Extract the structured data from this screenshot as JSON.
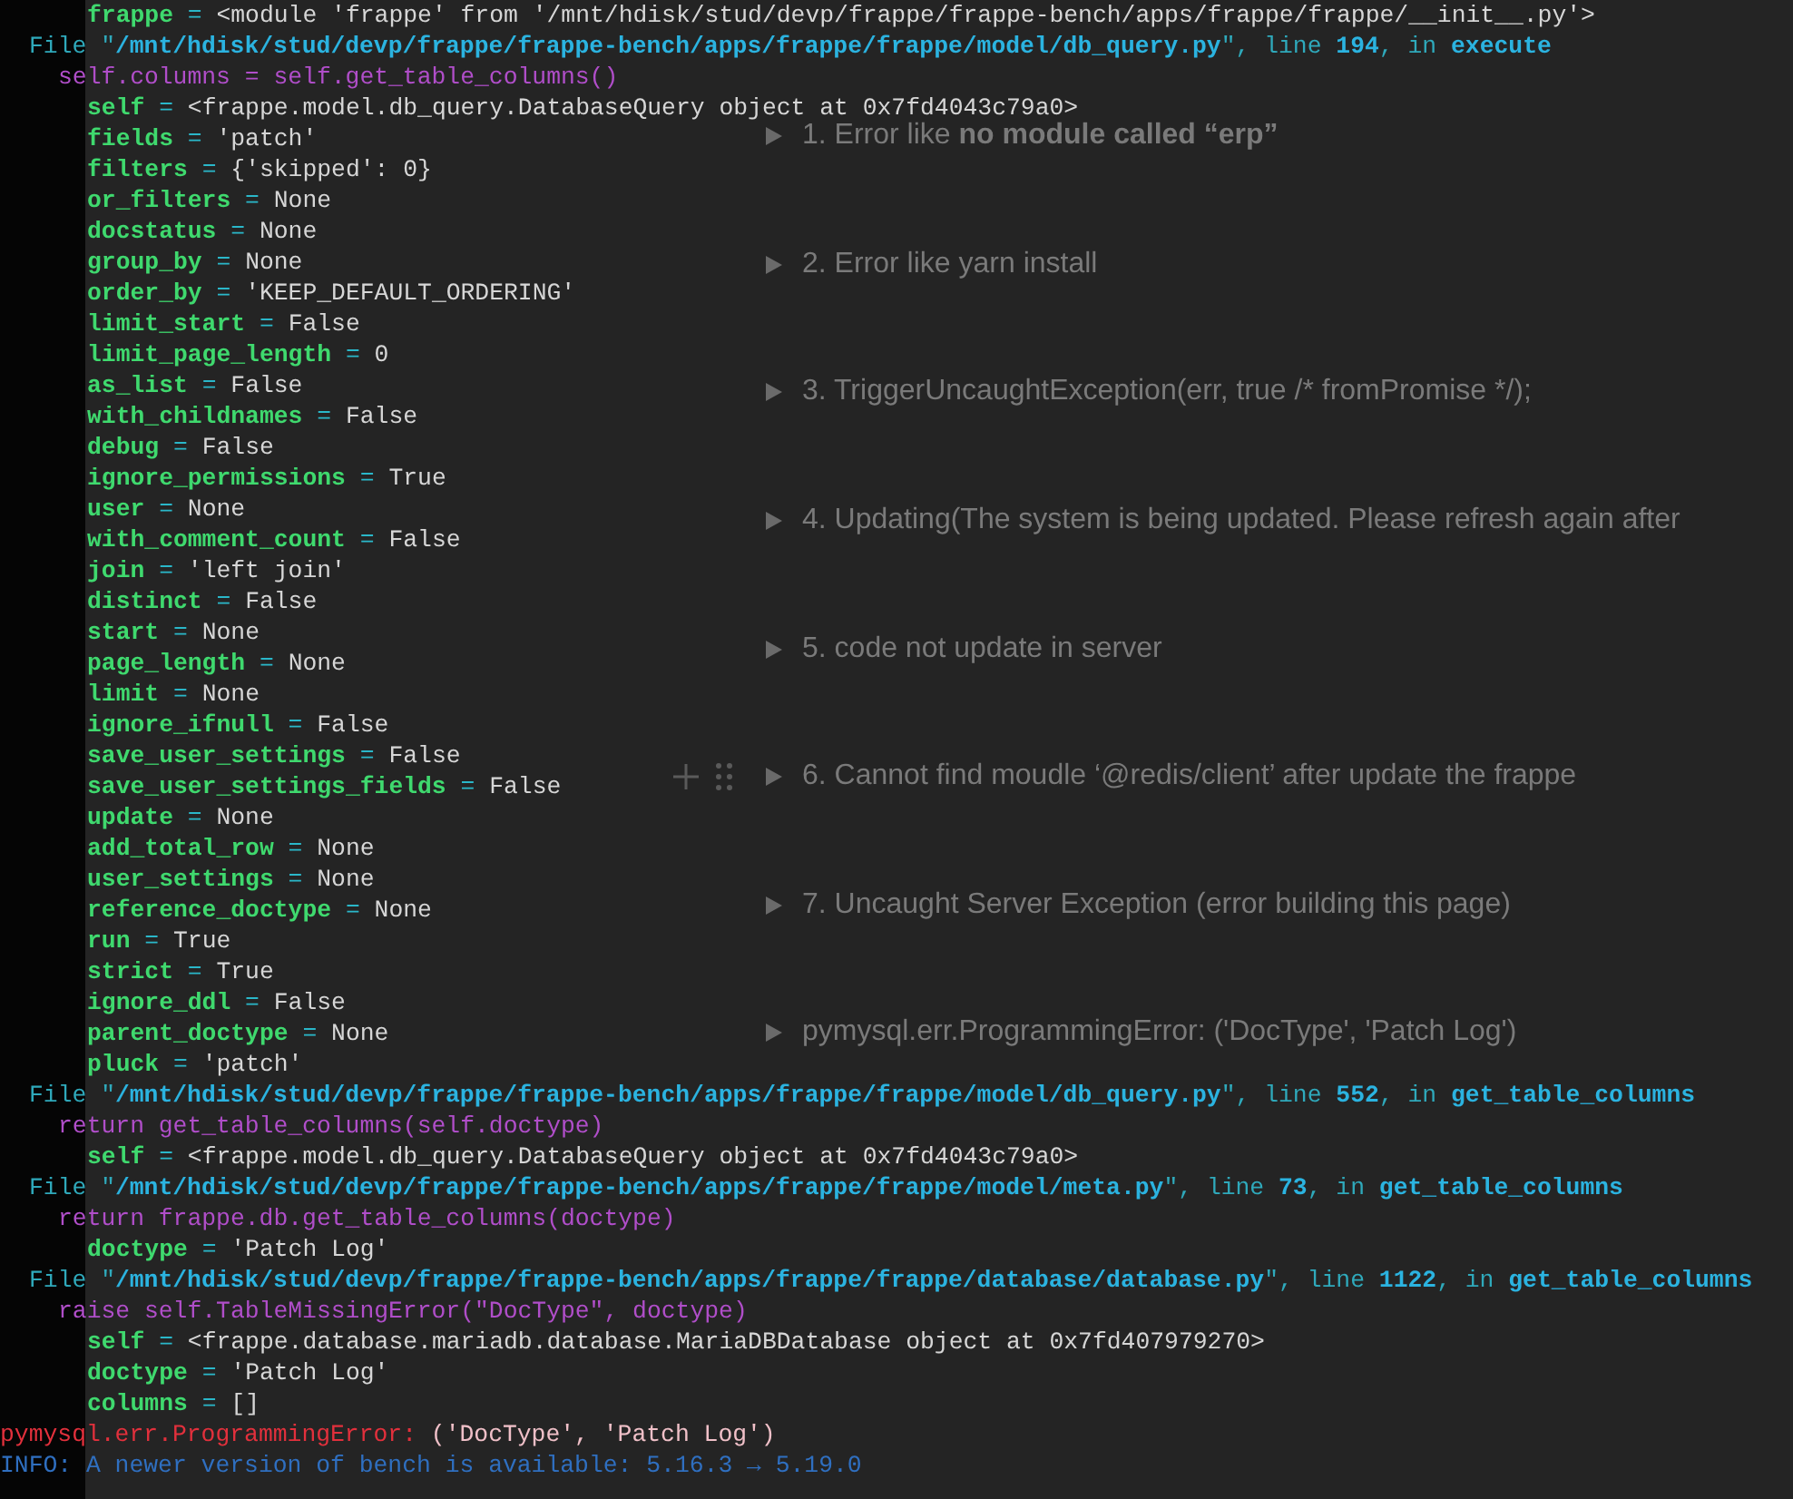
{
  "page": {
    "toggles": [
      {
        "text": "1. Error like **no module called “erp”**",
        "hovered": false
      },
      {
        "text": "2. Error like yarn install",
        "hovered": false
      },
      {
        "text": "3. TriggerUncaughtException(err, true /* fromPromise */);",
        "hovered": false
      },
      {
        "text": "4. Updating(The system is being updated. Please refresh again after",
        "hovered": false
      },
      {
        "text": "5. code not update in server",
        "hovered": false
      },
      {
        "text": "6. Cannot find moudle ‘@redis/client’ after update the frappe",
        "hovered": true
      },
      {
        "text": "7. Uncaught Server Exception (error building this page)",
        "hovered": false
      },
      {
        "text": "pymysql.err.ProgrammingError: ('DocType', 'Patch Log')",
        "hovered": false
      }
    ]
  },
  "terminal": {
    "lines": [
      {
        "kind": "var",
        "name": "frappe",
        "op": " = ",
        "value": "<module 'frappe' from '/mnt/hdisk/stud/devp/frappe/frappe-bench/apps/frappe/frappe/__init__.py'>"
      },
      {
        "kind": "file",
        "prefix": "File \"",
        "path": "/mnt/hdisk/stud/devp/frappe/frappe-bench/apps/frappe/frappe/model/db_query.py",
        "line_label": "\", line ",
        "line": "194",
        "in_label": ", in ",
        "func": "execute"
      },
      {
        "kind": "code",
        "text": "self.columns = self.get_table_columns()"
      },
      {
        "kind": "var",
        "name": "self",
        "op": " = ",
        "value": "<frappe.model.db_query.DatabaseQuery object at 0x7fd4043c79a0>"
      },
      {
        "kind": "var",
        "name": "fields",
        "op": " = ",
        "value": "'patch'"
      },
      {
        "kind": "var",
        "name": "filters",
        "op": " = ",
        "value": "{'skipped': 0}"
      },
      {
        "kind": "var",
        "name": "or_filters",
        "op": " = ",
        "value": "None"
      },
      {
        "kind": "var",
        "name": "docstatus",
        "op": " = ",
        "value": "None"
      },
      {
        "kind": "var",
        "name": "group_by",
        "op": " = ",
        "value": "None"
      },
      {
        "kind": "var",
        "name": "order_by",
        "op": " = ",
        "value": "'KEEP_DEFAULT_ORDERING'"
      },
      {
        "kind": "var",
        "name": "limit_start",
        "op": " = ",
        "value": "False"
      },
      {
        "kind": "var",
        "name": "limit_page_length",
        "op": " = ",
        "value": "0"
      },
      {
        "kind": "var",
        "name": "as_list",
        "op": " = ",
        "value": "False"
      },
      {
        "kind": "var",
        "name": "with_childnames",
        "op": " = ",
        "value": "False"
      },
      {
        "kind": "var",
        "name": "debug",
        "op": " = ",
        "value": "False"
      },
      {
        "kind": "var",
        "name": "ignore_permissions",
        "op": " = ",
        "value": "True"
      },
      {
        "kind": "var",
        "name": "user",
        "op": " = ",
        "value": "None"
      },
      {
        "kind": "var",
        "name": "with_comment_count",
        "op": " = ",
        "value": "False"
      },
      {
        "kind": "var",
        "name": "join",
        "op": " = ",
        "value": "'left join'"
      },
      {
        "kind": "var",
        "name": "distinct",
        "op": " = ",
        "value": "False"
      },
      {
        "kind": "var",
        "name": "start",
        "op": " = ",
        "value": "None"
      },
      {
        "kind": "var",
        "name": "page_length",
        "op": " = ",
        "value": "None"
      },
      {
        "kind": "var",
        "name": "limit",
        "op": " = ",
        "value": "None"
      },
      {
        "kind": "var",
        "name": "ignore_ifnull",
        "op": " = ",
        "value": "False"
      },
      {
        "kind": "var",
        "name": "save_user_settings",
        "op": " = ",
        "value": "False"
      },
      {
        "kind": "var",
        "name": "save_user_settings_fields",
        "op": " = ",
        "value": "False"
      },
      {
        "kind": "var",
        "name": "update",
        "op": " = ",
        "value": "None"
      },
      {
        "kind": "var",
        "name": "add_total_row",
        "op": " = ",
        "value": "None"
      },
      {
        "kind": "var",
        "name": "user_settings",
        "op": " = ",
        "value": "None"
      },
      {
        "kind": "var",
        "name": "reference_doctype",
        "op": " = ",
        "value": "None"
      },
      {
        "kind": "var",
        "name": "run",
        "op": " = ",
        "value": "True"
      },
      {
        "kind": "var",
        "name": "strict",
        "op": " = ",
        "value": "True"
      },
      {
        "kind": "var",
        "name": "ignore_ddl",
        "op": " = ",
        "value": "False"
      },
      {
        "kind": "var",
        "name": "parent_doctype",
        "op": " = ",
        "value": "None"
      },
      {
        "kind": "var",
        "name": "pluck",
        "op": " = ",
        "value": "'patch'"
      },
      {
        "kind": "file",
        "prefix": "File \"",
        "path": "/mnt/hdisk/stud/devp/frappe/frappe-bench/apps/frappe/frappe/model/db_query.py",
        "line_label": "\", line ",
        "line": "552",
        "in_label": ", in ",
        "func": "get_table_columns"
      },
      {
        "kind": "code",
        "text": "return get_table_columns(self.doctype)"
      },
      {
        "kind": "var",
        "name": "self",
        "op": " = ",
        "value": "<frappe.model.db_query.DatabaseQuery object at 0x7fd4043c79a0>"
      },
      {
        "kind": "file",
        "prefix": "File \"",
        "path": "/mnt/hdisk/stud/devp/frappe/frappe-bench/apps/frappe/frappe/model/meta.py",
        "line_label": "\", line ",
        "line": "73",
        "in_label": ", in ",
        "func": "get_table_columns"
      },
      {
        "kind": "code",
        "text": "return frappe.db.get_table_columns(doctype)"
      },
      {
        "kind": "var",
        "name": "doctype",
        "op": " = ",
        "value": "'Patch Log'"
      },
      {
        "kind": "file",
        "prefix": "File \"",
        "path": "/mnt/hdisk/stud/devp/frappe/frappe-bench/apps/frappe/frappe/database/database.py",
        "line_label": "\", line ",
        "line": "1122",
        "in_label": ", in ",
        "func": "get_table_columns"
      },
      {
        "kind": "code",
        "text": "raise self.TableMissingError(\"DocType\", doctype)"
      },
      {
        "kind": "var",
        "name": "self",
        "op": " = ",
        "value": "<frappe.database.mariadb.database.MariaDBDatabase object at 0x7fd407979270>"
      },
      {
        "kind": "var",
        "name": "doctype",
        "op": " = ",
        "value": "'Patch Log'"
      },
      {
        "kind": "var",
        "name": "columns",
        "op": " = ",
        "value": "[]"
      },
      {
        "kind": "error",
        "error": "pymysql.err.ProgrammingError:",
        "detail": " ('DocType', 'Patch Log')"
      },
      {
        "kind": "info",
        "text": "INFO: A newer version of bench is available: 5.16.3 → 5.19.0"
      }
    ]
  }
}
